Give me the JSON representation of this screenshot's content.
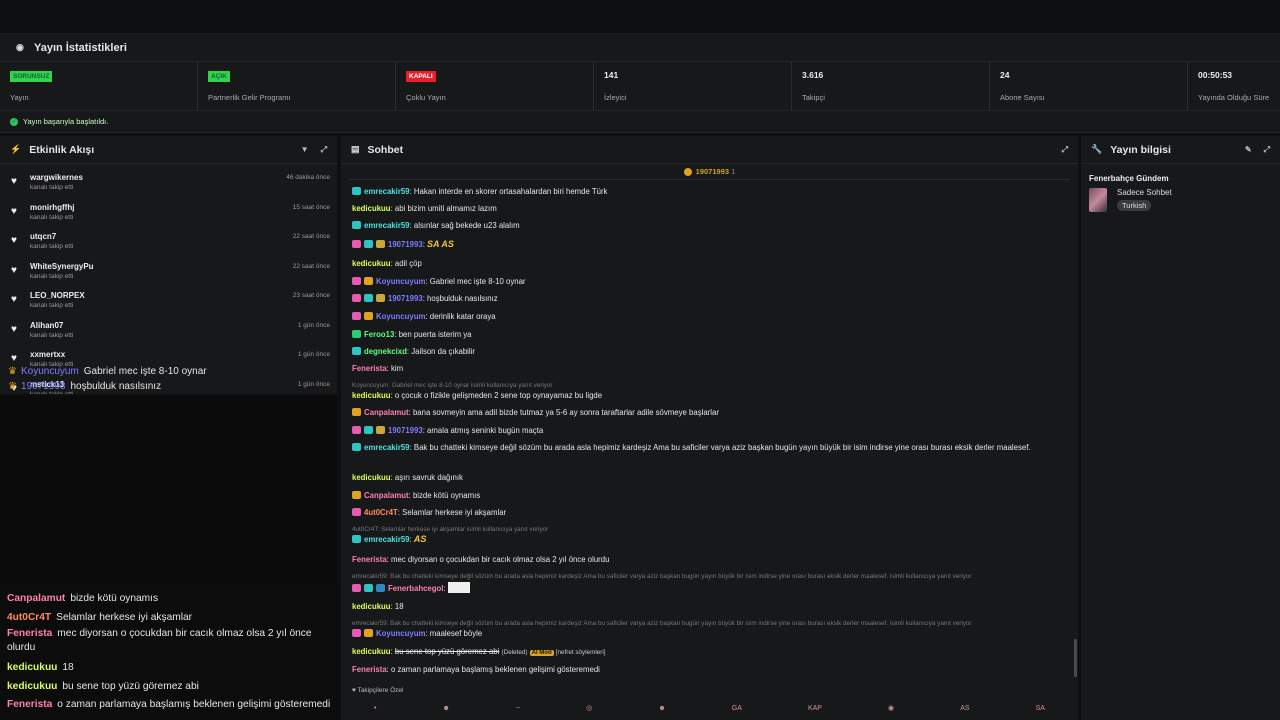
{
  "stats_panel": {
    "title": "Yayın İstatistikleri",
    "items": [
      {
        "badge": "SORUNSUZ",
        "badge_color": "#34d24c",
        "label": "Yayın"
      },
      {
        "badge": "AÇIK",
        "badge_color": "#34d24c",
        "label": "Partnerlik Gelir Programı"
      },
      {
        "badge": "KAPALI",
        "badge_color": "#e5202a",
        "label": "Çoklu Yayın"
      },
      {
        "value": "141",
        "label": "İzleyici"
      },
      {
        "value": "3.616",
        "label": "Takipçi"
      },
      {
        "value": "24",
        "label": "Abone Sayısı"
      },
      {
        "value": "00:50:53",
        "label": "Yayında Olduğu Süre"
      }
    ],
    "status": "Yayın başarıyla başlatıldı."
  },
  "activity": {
    "title": "Etkinlik Akışı",
    "items": [
      {
        "name": "wargwikernes",
        "sub": "kanalı takip etti",
        "time": "46 dakika önce"
      },
      {
        "name": "monirhgffhj",
        "sub": "kanalı takip etti",
        "time": "15 saat önce"
      },
      {
        "name": "utqcn7",
        "sub": "kanalı takip etti",
        "time": "22 saat önce"
      },
      {
        "name": "WhiteSynergyPu",
        "sub": "kanalı takip etti",
        "time": "22 saat önce"
      },
      {
        "name": "LEO_NORPEX",
        "sub": "kanalı takip etti",
        "time": "23 saat önce"
      },
      {
        "name": "Alihan07",
        "sub": "kanalı takip etti",
        "time": "1 gün önce"
      },
      {
        "name": "xxmertxx",
        "sub": "kanalı takip etti",
        "time": "1 gün önce"
      },
      {
        "name": "mstick13",
        "sub": "kanalı takip etti",
        "time": "1 gün önce"
      }
    ]
  },
  "overlay_top": [
    {
      "user": "Koyuncuyum",
      "color": "#7d7dff",
      "text": "Gabriel mec işte 8-10 oynar"
    },
    {
      "user": "19071993",
      "color": "#7d7dff",
      "text": "hoşbulduk nasılsınız"
    }
  ],
  "overlay_chat": [
    {
      "user": "Canpalamut",
      "color": "#ff7fb0",
      "text": "bizde kötü oynamıs"
    },
    {
      "user": "4ut0Cr4T",
      "color": "#ff8a5c",
      "text": "Selamlar herkese iyi akşamlar"
    },
    {
      "user": "Fenerista",
      "color": "#ff7fb0",
      "text": "mec diyorsan o çocukdan bir cacık olmaz olsa 2 yıl önce olurdu"
    },
    {
      "user": "kedicukuu",
      "color": "#d7ff5c",
      "text": "18"
    },
    {
      "user": "kedicukuu",
      "color": "#d7ff5c",
      "text": "bu sene top yüzü göremez abi"
    },
    {
      "user": "Fenerista",
      "color": "#ff7fb0",
      "text": "o zaman parlamaya başlamış beklenen gelişimi gösteremedi"
    }
  ],
  "chat": {
    "title": "Sohbet",
    "pinned_user": "19071993",
    "pinned_count": "1",
    "messages": [
      {
        "user": "emrecakir59",
        "color": "#4fe0e0",
        "badges": [
          "#2ec4c4"
        ],
        "text": "Hakan interde en skorer ortasahalardan biri hemde Türk"
      },
      {
        "user": "kedicukuu",
        "color": "#d7ff5c",
        "badges": [],
        "text": "abi bizim umiti almamız lazım"
      },
      {
        "user": "emrecakir59",
        "color": "#4fe0e0",
        "badges": [
          "#2ec4c4"
        ],
        "text": "alsınlar sağ bekede u23 alalım"
      },
      {
        "user": "19071993",
        "color": "#7d7dff",
        "badges": [
          "#e45bb0",
          "#2ec4c4",
          "#c9a83d"
        ],
        "text": "SA AS"
      },
      {
        "user": "kedicukuu",
        "color": "#d7ff5c",
        "badges": [],
        "text": "adil çöp"
      },
      {
        "user": "Koyuncuyum",
        "color": "#7d7dff",
        "badges": [
          "#e45bb0",
          "#e1a21d"
        ],
        "text": "Gabriel mec işte 8-10 oynar"
      },
      {
        "user": "19071993",
        "color": "#7d7dff",
        "badges": [
          "#e45bb0",
          "#2ec4c4",
          "#c9a83d"
        ],
        "text": "hoşbulduk nasılsınız"
      },
      {
        "user": "Koyuncuyum",
        "color": "#7d7dff",
        "badges": [
          "#e45bb0",
          "#e1a21d"
        ],
        "text": "derinlik katar oraya"
      },
      {
        "user": "Feroo13",
        "color": "#5cff7f",
        "badges": [
          "#2ecc71"
        ],
        "text": "ben puerta isterim ya"
      },
      {
        "user": "degnekcixd",
        "color": "#5cff7f",
        "badges": [
          "#2ec4c4"
        ],
        "text": "Jailson da çıkabilir"
      },
      {
        "user": "Fenerista",
        "color": "#ff7fb0",
        "badges": [],
        "text": "kim"
      },
      {
        "reply": "Koyuncuyum: Gabriel mec işte 8-10 oynar isimli kullanıcıya yanıt veriyor"
      },
      {
        "user": "kedicukuu",
        "color": "#d7ff5c",
        "badges": [],
        "text": "o çocuk o fizikle gelişmeden 2 sene top oynayamaz bu ligde"
      },
      {
        "user": "Canpalamut",
        "color": "#ff7fb0",
        "badges": [
          "#e1a21d"
        ],
        "text": "bana sovmeyin ama adil bizde tutmaz ya 5-6 ay sonra taraftarlar adile sövmeye başlarlar"
      },
      {
        "user": "19071993",
        "color": "#7d7dff",
        "badges": [
          "#e45bb0",
          "#2ec4c4",
          "#c9a83d"
        ],
        "text": "amala atmış seninki bugün maçta"
      },
      {
        "user": "emrecakir59",
        "color": "#4fe0e0",
        "badges": [
          "#2ec4c4"
        ],
        "text": "Bak bu chatteki kimseye değil sözüm bu arada asla hepimiz kardeşiz Ama bu saficiler varya aziz başkan bugün yayın büyük bir isim indirse yine orası burası eksik derler maalesef."
      },
      {
        "user": "kedicukuu",
        "color": "#d7ff5c",
        "badges": [],
        "text": "aşırı savruk dağınık"
      },
      {
        "user": "Canpalamut",
        "color": "#ff7fb0",
        "badges": [
          "#e1a21d"
        ],
        "text": "bizde kötü oynamıs"
      },
      {
        "user": "4ut0Cr4T",
        "color": "#ff8a5c",
        "badges": [
          "#e45bb0"
        ],
        "text": "Selamlar herkese iyi akşamlar"
      },
      {
        "reply": "4ut0Cr4T: Selamlar herkese iyi akşamlar isimli kullanıcıya yanıt veriyor"
      },
      {
        "user": "emrecakir59",
        "color": "#4fe0e0",
        "badges": [
          "#2ec4c4"
        ],
        "text": "AS"
      },
      {
        "user": "Fenerista",
        "color": "#ff7fb0",
        "badges": [],
        "text": "mec diyorsan o çocukdan bir cacık olmaz olsa 2 yıl önce olurdu"
      },
      {
        "reply": "emrecakir59: Bak bu chatteki kimseye değil sözüm bu arada asla hepimiz kardeşiz Ama bu saficiler varya aziz başkan bugün yayın büyük bir isim indirse yine orası burası eksik derler maalesef. isimli kullanıcıya yanıt veriyor"
      },
      {
        "user": "Fenerbahcegol",
        "color": "#ff7fb0",
        "badges": [
          "#e45bb0",
          "#2ec4c4",
          "#2e86c4"
        ],
        "text": ""
      },
      {
        "user": "kedicukuu",
        "color": "#d7ff5c",
        "badges": [],
        "text": "18"
      },
      {
        "reply": "emrecakir59: Bak bu chatteki kimseye değil sözüm bu arada asla hepimiz kardeşiz Ama bu saficiler varya aziz başkan bugün yayın büyük bir isim indirse yine orası burası eksik derler maalesef. isimli kullanıcıya yanıt veriyor"
      },
      {
        "user": "Koyuncuyum",
        "color": "#7d7dff",
        "badges": [
          "#e45bb0",
          "#e1a21d"
        ],
        "text": "maalesef böyle"
      },
      {
        "user": "kedicukuu",
        "color": "#d7ff5c",
        "badges": [],
        "text": "bu sene top yüzü göremez abi",
        "deleted": "(Deleted)",
        "mod": "AI Mod",
        "reason": "[nefret söylemleri]"
      },
      {
        "user": "Fenerista",
        "color": "#ff7fb0",
        "badges": [],
        "text": "o zaman parlamaya başlamış beklenen gelişimi gösteremedi"
      }
    ],
    "follow_note": "Takipçilere Özel",
    "emotes": [
      "•",
      "☻",
      "~",
      "◎",
      "☻",
      "GA",
      "KAP",
      "◉",
      "AS",
      "SA"
    ]
  },
  "info": {
    "title": "Yayın bilgisi",
    "stream_title": "Fenerbahçe Gündem",
    "category": "Sadece Sohbet",
    "tag": "Turkish"
  }
}
